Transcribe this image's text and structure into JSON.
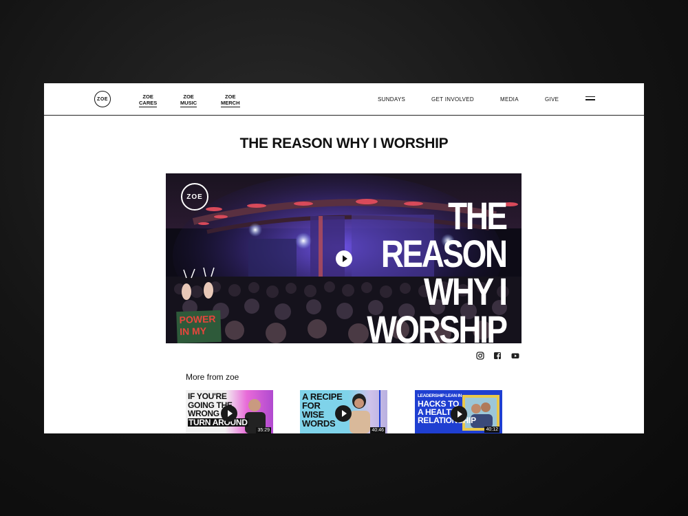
{
  "header": {
    "logo_text": "ZOE",
    "sub_links": [
      {
        "top": "ZOE",
        "bottom": "CARES"
      },
      {
        "top": "ZOE",
        "bottom": "MUSIC"
      },
      {
        "top": "ZOE",
        "bottom": "MERCH"
      }
    ],
    "nav": [
      "SUNDAYS",
      "GET INVOLVED",
      "MEDIA",
      "GIVE"
    ],
    "menu_icon": "hamburger-menu-icon"
  },
  "page": {
    "title": "THE REASON WHY I WORSHIP"
  },
  "hero": {
    "logo_text": "ZOE",
    "headline": [
      "THE",
      "REASON",
      "WHY I",
      "WORSHIP"
    ],
    "sign_text": [
      "POWER",
      "IN MY"
    ],
    "play_icon": "play-icon"
  },
  "social": [
    "instagram-icon",
    "facebook-icon",
    "youtube-icon"
  ],
  "more": {
    "title": "More from zoe",
    "videos": [
      {
        "caption": [
          "IF YOU'RE",
          "GOING THE",
          "WRONG W",
          "TURN AROUND"
        ],
        "duration": "35:29"
      },
      {
        "caption": [
          "A RECIPE",
          "FOR",
          "WISE",
          "WORDS"
        ],
        "duration": "40:46"
      },
      {
        "caption": [
          "LEADERSHIP LEAN IN",
          "HACKS TO",
          "A HEALTHY",
          "RELATIONSHIP"
        ],
        "duration": "40:12"
      }
    ]
  },
  "colors": {
    "accent_blue": "#1f3fd1",
    "pink": "#e86ad8",
    "cyan": "#7fd3ea"
  }
}
